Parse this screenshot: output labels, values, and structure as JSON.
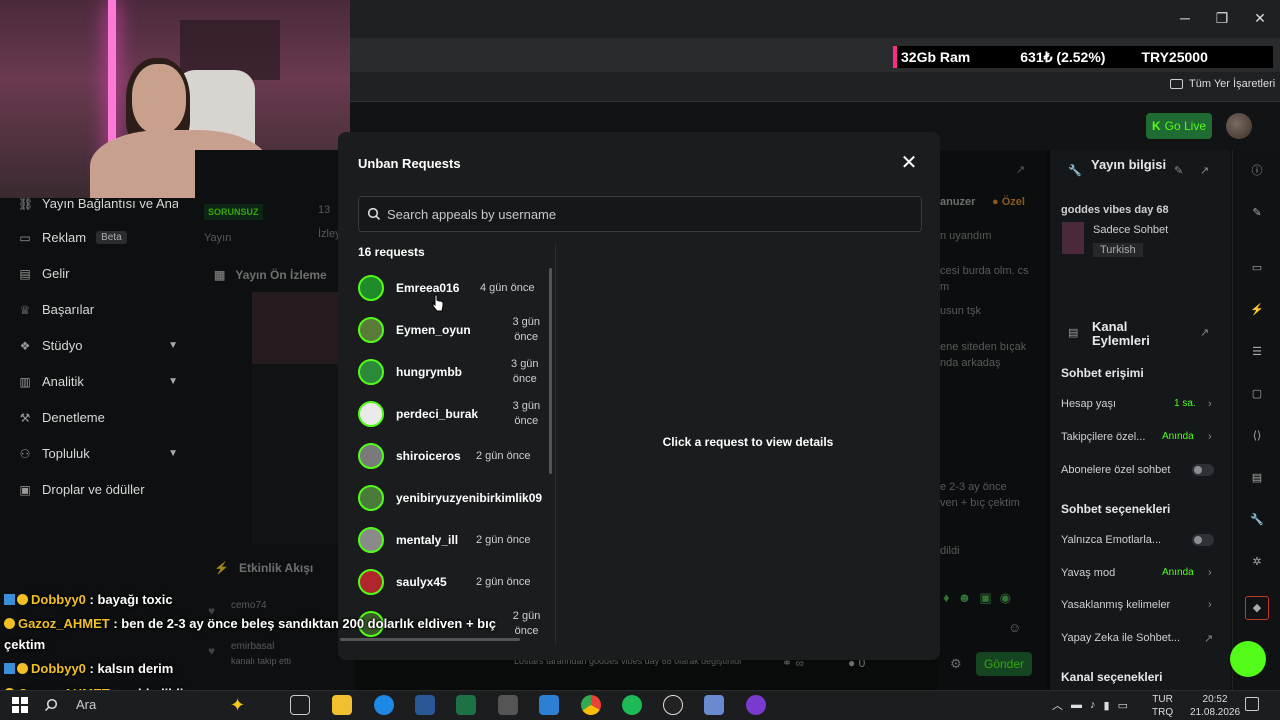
{
  "browser": {
    "window_controls": {
      "minimize": "─",
      "maximize": "❐",
      "close": "✕"
    },
    "bookmarks_label": "Tüm Yer İşaretleri"
  },
  "stream_stats": {
    "ram": "32Gb Ram",
    "change": "631₺ (2.52%)",
    "price": "TRY25000"
  },
  "app_header": {
    "go_live_label": "Go Live"
  },
  "sidebar": {
    "items": [
      {
        "label": "Yayın Bağlantısı ve Anahtarı",
        "icon": "link-icon"
      },
      {
        "label": "Reklam",
        "badge": "Beta",
        "icon": "ad-icon"
      },
      {
        "label": "Gelir",
        "icon": "money-icon"
      },
      {
        "label": "Başarılar",
        "icon": "trophy-icon"
      },
      {
        "label": "Stüdyo",
        "icon": "studio-icon"
      },
      {
        "label": "Analitik",
        "icon": "chart-icon"
      },
      {
        "label": "Denetleme",
        "icon": "hammer-icon"
      },
      {
        "label": "Topluluk",
        "icon": "community-icon"
      },
      {
        "label": "Droplar ve ödüller",
        "icon": "gift-icon"
      }
    ]
  },
  "dashboard": {
    "status_badge": "SORUNSUZ",
    "stat_value": "13",
    "stat_label_1": "Yayın",
    "stat_label_2": "İzleyi",
    "preview_title": "Yayın Ön İzleme",
    "activity_title": "Etkinlik Akışı",
    "activity_items": [
      {
        "user": "cemo74",
        "text": ""
      },
      {
        "user": "emirbasal",
        "text": "kanalı takip etti"
      }
    ],
    "footer_text": "Lostars tarafından goddes vibes day 68 olarak değiştirildi"
  },
  "chat_panel": {
    "mod_label": "anuzer",
    "special_label": "Özel",
    "lines": [
      "n uyandım",
      "cesi burda olm. cs",
      "m",
      "usun tşk",
      "ene siteden bıçak",
      "nda arkadaş",
      "e 2-3 ay önce",
      "ven + bıç çektim",
      "dildi"
    ],
    "viewers": "0",
    "send_label": "Gönder"
  },
  "right_panel": {
    "stream_info_title": "Yayın bilgisi",
    "stream_title": "goddes vibes day 68",
    "category": "Sadece Sohbet",
    "language_tag": "Turkish",
    "channel_actions_title": "Kanal Eylemleri",
    "chat_access_title": "Sohbet erişimi",
    "account_age": {
      "label": "Hesap yaşı",
      "value": "1 sa."
    },
    "followers_only": {
      "label": "Takipçilere özel...",
      "value": "Anında"
    },
    "subscribers_only": {
      "label": "Abonelere özel sohbet"
    },
    "chat_options_title": "Sohbet seçenekleri",
    "emotes_only": {
      "label": "Yalnızca Emotlarla..."
    },
    "slow_mode": {
      "label": "Yavaş mod",
      "value": "Anında"
    },
    "banned_words": {
      "label": "Yasaklanmış kelimeler"
    },
    "ai_chat": {
      "label": "Yapay Zeka ile Sohbet..."
    },
    "channel_options_title": "Kanal seçenekleri"
  },
  "modal": {
    "title": "Unban Requests",
    "search_placeholder": "Search appeals by username",
    "count_label": "16 requests",
    "empty_detail": "Click a request to view details",
    "requests": [
      {
        "username": "Emreea016",
        "time": "4 gün önce"
      },
      {
        "username": "Eymen_oyun",
        "time": "3 gün önce"
      },
      {
        "username": "hungrymbb",
        "time": "3 gün önce"
      },
      {
        "username": "perdeci_burak",
        "time": "3 gün önce"
      },
      {
        "username": "shiroiceros",
        "time": "2 gün önce"
      },
      {
        "username": "yenibiryuzyenibirkimlik09",
        "time": ""
      },
      {
        "username": "mentaly_ill",
        "time": "2 gün önce"
      },
      {
        "username": "saulyx45",
        "time": "2 gün önce"
      },
      {
        "username": "",
        "time": "2 gün önce"
      }
    ]
  },
  "stream_chat": [
    {
      "user": "Dobbyy0",
      "message": ": bayağı toxic"
    },
    {
      "user": "Gazoz_AHMET",
      "message": ": ben de 2-3 ay önce beleş sandıktan 200 dolarlık eldiven + bıç"
    },
    {
      "user": "",
      "message": "çektim"
    },
    {
      "user": "Dobbyy0",
      "message": ": kalsın derim"
    },
    {
      "user": "Gazoz_AHMET",
      "message": ": reddedildi"
    }
  ],
  "taskbar": {
    "search_label": "Ara",
    "lang": "TUR",
    "lang_sub": "TRQ",
    "time": "20:52",
    "date": "21.08.2026"
  },
  "colors": {
    "accent": "#53fc18",
    "background": "#0f1112",
    "modal": "#1a1c1e",
    "stats_pink": "#ff2a8a"
  }
}
